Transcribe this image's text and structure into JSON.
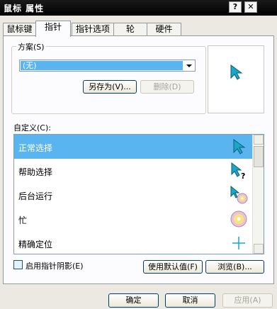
{
  "window": {
    "title": "鼠标 属性",
    "help_label": "?",
    "close_label": "✕"
  },
  "tabs": [
    {
      "label": "鼠标键",
      "active": false
    },
    {
      "label": "指针",
      "active": true
    },
    {
      "label": "指针选项",
      "active": false
    },
    {
      "label": "轮",
      "active": false
    },
    {
      "label": "硬件",
      "active": false
    }
  ],
  "scheme": {
    "label": "方案(S)",
    "value": "(无)",
    "save_as_label": "另存为(V)...",
    "delete_label": "删除(D)"
  },
  "customize": {
    "label": "自定义(C):",
    "items": [
      {
        "label": "正常选择",
        "icon": "arrow-cursor-icon",
        "selected": true
      },
      {
        "label": "帮助选择",
        "icon": "help-cursor-icon",
        "selected": false
      },
      {
        "label": "后台运行",
        "icon": "working-in-background-cursor-icon",
        "selected": false
      },
      {
        "label": "忙",
        "icon": "busy-cursor-icon",
        "selected": false
      },
      {
        "label": "精确定位",
        "icon": "crosshair-cursor-icon",
        "selected": false
      }
    ]
  },
  "shadow_checkbox": {
    "label": "启用指针阴影(E)",
    "checked": false
  },
  "buttons": {
    "use_default": "使用默认值(F)",
    "browse": "浏览(B)...",
    "ok": "确定",
    "cancel": "取消",
    "apply": "应用(A)"
  },
  "colors": {
    "accent": "#5ab4ef",
    "cursor": "#1aa6c8",
    "title_bar": "#000000"
  }
}
